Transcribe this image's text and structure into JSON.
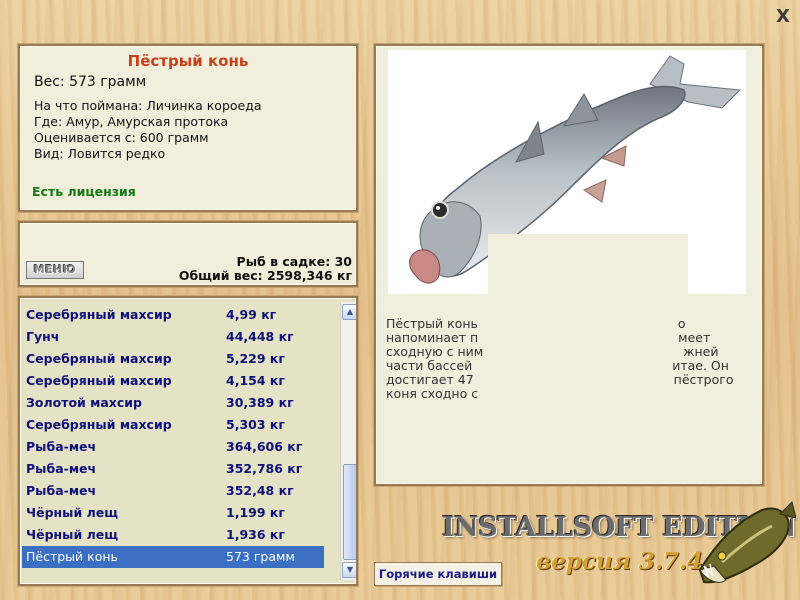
{
  "close": {
    "label": "X"
  },
  "fish_info": {
    "title": "Пёстрый конь",
    "weight_text": "Вес: 573 грамм",
    "lines": [
      "На что поймана: Личинка короеда",
      "Где: Амур, Амурская протока",
      "Оценивается с: 600 грамм",
      "Вид: Ловится редко"
    ],
    "license": "Есть лицензия"
  },
  "stats": {
    "menu_label": "МЕНЮ",
    "fish_count": "Рыб в садке: 30",
    "total_weight": "Общий вес: 2598,346 кг"
  },
  "catch_list": [
    {
      "name": "Серебряный махсир",
      "weight": "4,99 кг"
    },
    {
      "name": "Гунч",
      "weight": "44,448 кг"
    },
    {
      "name": "Серебряный махсир",
      "weight": "5,229 кг"
    },
    {
      "name": "Серебряный махсир",
      "weight": "4,154 кг"
    },
    {
      "name": "Золотой махсир",
      "weight": "30,389 кг"
    },
    {
      "name": "Серебряный махсир",
      "weight": "5,303 кг"
    },
    {
      "name": "Рыба-меч",
      "weight": "364,606 кг"
    },
    {
      "name": "Рыба-меч",
      "weight": "352,786 кг"
    },
    {
      "name": "Рыба-меч",
      "weight": "352,48 кг"
    },
    {
      "name": "Чёрный лещ",
      "weight": "1,199 кг"
    },
    {
      "name": "Чёрный лещ",
      "weight": "1,936 кг"
    },
    {
      "name": "Пёстрый конь",
      "weight": "573 грамм",
      "selected": true
    }
  ],
  "description": {
    "lines": [
      {
        "left": "Пёстрый конь",
        "right": "о"
      },
      {
        "left": "напоминает п",
        "right": "меет"
      },
      {
        "left": "сходную с ним",
        "right": "жней"
      },
      {
        "left": "части бассей",
        "right": "итае. Он"
      },
      {
        "left": "достигает 47",
        "right": "пёстрого"
      },
      {
        "left": "коня сходно с",
        "right": ""
      }
    ]
  },
  "buttons": {
    "hotkeys": "Горячие клавиши"
  },
  "branding": {
    "edition": "INSTALLSOFT EDITION",
    "version": "версия 3.7.4"
  },
  "icons": [
    "close-icon",
    "scroll-up-icon",
    "scroll-down-icon",
    "fish-photo",
    "pike-logo"
  ]
}
